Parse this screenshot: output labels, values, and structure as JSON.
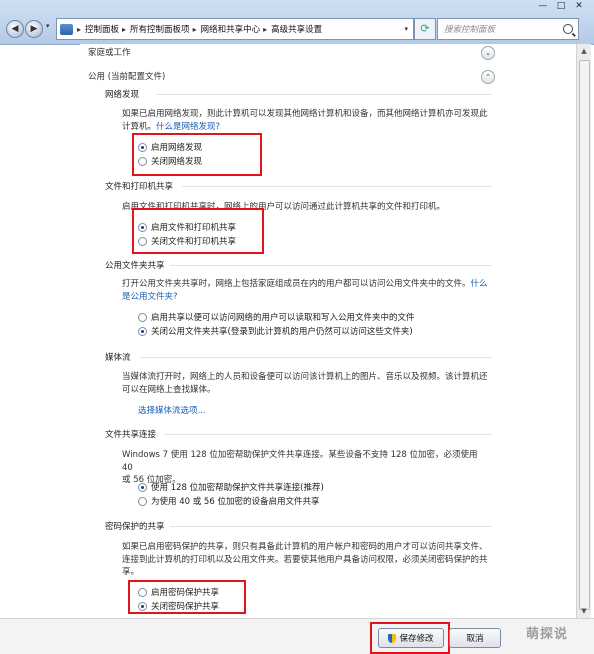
{
  "window": {
    "breadcrumbs": [
      "控制面板",
      "所有控制面板项",
      "网络和共享中心",
      "高级共享设置"
    ],
    "search_placeholder": "搜索控制面板",
    "controls": {
      "minimize": "—",
      "maximize": "□",
      "close": "✕"
    }
  },
  "profiles": {
    "home_work": "家庭或工作",
    "public": "公用 (当前配置文件)"
  },
  "network_discovery": {
    "heading": "网络发现",
    "desc_line1": "如果已启用网络发现，则此计算机可以发现其他网络计算机和设备，而其他网络计算机亦可发现此",
    "desc_line2": "计算机。",
    "link": "什么是网络发现?",
    "options": [
      {
        "label": "启用网络发现",
        "selected": true
      },
      {
        "label": "关闭网络发现",
        "selected": false
      }
    ]
  },
  "file_printer": {
    "heading": "文件和打印机共享",
    "desc": "启用文件和打印机共享时，网络上的用户可以访问通过此计算机共享的文件和打印机。",
    "options": [
      {
        "label": "启用文件和打印机共享",
        "selected": true
      },
      {
        "label": "关闭文件和打印机共享",
        "selected": false
      }
    ]
  },
  "public_folder": {
    "heading": "公用文件夹共享",
    "desc_line1": "打开公用文件夹共享时，网络上包括家庭组成员在内的用户都可以访问公用文件夹中的文件。",
    "desc_link1": "什么",
    "desc_link2": "是公用文件夹?",
    "options": [
      {
        "label": "启用共享以便可以访问网络的用户可以读取和写入公用文件夹中的文件",
        "selected": false
      },
      {
        "label": "关闭公用文件夹共享(登录到此计算机的用户仍然可以访问这些文件夹)",
        "selected": true
      }
    ]
  },
  "media_streaming": {
    "heading": "媒体流",
    "desc_line1": "当媒体流打开时，网络上的人员和设备便可以访问该计算机上的图片、音乐以及视频。该计算机还",
    "desc_line2": "可以在网络上查找媒体。",
    "link": "选择媒体流选项..."
  },
  "file_sharing_connection": {
    "heading": "文件共享连接",
    "desc_line1": "Windows 7 使用 128 位加密帮助保护文件共享连接。某些设备不支持 128 位加密，必须使用 40",
    "desc_line2": "或 56 位加密。",
    "options": [
      {
        "label": "使用 128 位加密帮助保护文件共享连接(推荐)",
        "selected": true
      },
      {
        "label": "为使用 40 或 56 位加密的设备启用文件共享",
        "selected": false
      }
    ]
  },
  "password_sharing": {
    "heading": "密码保护的共享",
    "desc_line1": "如果已启用密码保护的共享，则只有具备此计算机的用户帐户和密码的用户才可以访问共享文件、",
    "desc_line2": "连接到此计算机的打印机以及公用文件夹。若要使其他用户具备访问权限，必须关闭密码保护的共",
    "desc_line3": "享。",
    "options": [
      {
        "label": "启用密码保护共享",
        "selected": false
      },
      {
        "label": "关闭密码保护共享",
        "selected": true
      }
    ]
  },
  "footer": {
    "save_label": "保存修改",
    "cancel_label": "取消"
  },
  "watermark": "萌探说"
}
